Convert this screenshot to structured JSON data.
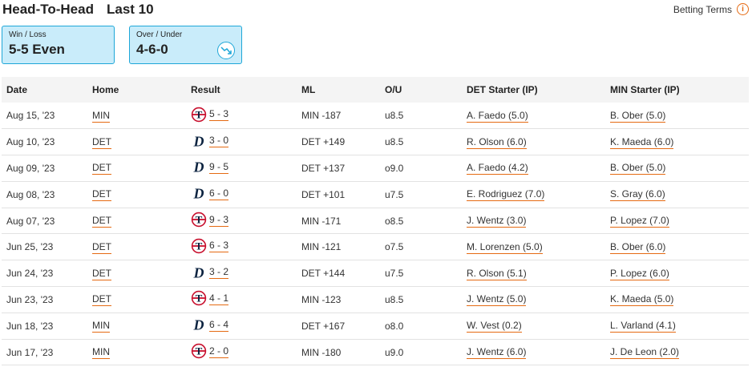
{
  "header": {
    "title": "Head-To-Head",
    "subtitle": "Last 10"
  },
  "betting_terms": {
    "label": "Betting Terms",
    "icon": "info-icon"
  },
  "cards": {
    "win_loss": {
      "label": "Win / Loss",
      "value": "5-5 Even"
    },
    "over_under": {
      "label": "Over / Under",
      "value": "4-6-0",
      "icon": "trend-down-icon"
    }
  },
  "colors": {
    "accent": "#e56a12",
    "card_bg": "#c9ecfa",
    "card_border": "#1ea7d8",
    "twins_red": "#c8102e",
    "twins_navy": "#0c2340",
    "tigers_navy": "#0c2340"
  },
  "table": {
    "columns": [
      "Date",
      "Home",
      "Result",
      "ML",
      "O/U",
      "DET Starter (IP)",
      "MIN Starter (IP)"
    ],
    "rows": [
      {
        "date": "Aug 15, '23",
        "home": "MIN",
        "winner": "MIN",
        "score": "5 - 3",
        "ml": "MIN -187",
        "ou": "u8.5",
        "det": "A. Faedo (5.0)",
        "min": "B. Ober (5.0)"
      },
      {
        "date": "Aug 10, '23",
        "home": "DET",
        "winner": "DET",
        "score": "3 - 0",
        "ml": "DET +149",
        "ou": "u8.5",
        "det": "R. Olson (6.0)",
        "min": "K. Maeda (6.0)"
      },
      {
        "date": "Aug 09, '23",
        "home": "DET",
        "winner": "DET",
        "score": "9 - 5",
        "ml": "DET +137",
        "ou": "o9.0",
        "det": "A. Faedo (4.2)",
        "min": "B. Ober (5.0)"
      },
      {
        "date": "Aug 08, '23",
        "home": "DET",
        "winner": "DET",
        "score": "6 - 0",
        "ml": "DET +101",
        "ou": "u7.5",
        "det": "E. Rodriguez (7.0)",
        "min": "S. Gray (6.0)"
      },
      {
        "date": "Aug 07, '23",
        "home": "DET",
        "winner": "MIN",
        "score": "9 - 3",
        "ml": "MIN -171",
        "ou": "o8.5",
        "det": "J. Wentz (3.0)",
        "min": "P. Lopez (7.0)"
      },
      {
        "date": "Jun 25, '23",
        "home": "DET",
        "winner": "MIN",
        "score": "6 - 3",
        "ml": "MIN -121",
        "ou": "o7.5",
        "det": "M. Lorenzen (5.0)",
        "min": "B. Ober (6.0)"
      },
      {
        "date": "Jun 24, '23",
        "home": "DET",
        "winner": "DET",
        "score": "3 - 2",
        "ml": "DET +144",
        "ou": "u7.5",
        "det": "R. Olson (5.1)",
        "min": "P. Lopez (6.0)"
      },
      {
        "date": "Jun 23, '23",
        "home": "DET",
        "winner": "MIN",
        "score": "4 - 1",
        "ml": "MIN -123",
        "ou": "u8.5",
        "det": "J. Wentz (5.0)",
        "min": "K. Maeda (5.0)"
      },
      {
        "date": "Jun 18, '23",
        "home": "MIN",
        "winner": "DET",
        "score": "6 - 4",
        "ml": "DET +167",
        "ou": "o8.0",
        "det": "W. Vest (0.2)",
        "min": "L. Varland (4.1)"
      },
      {
        "date": "Jun 17, '23",
        "home": "MIN",
        "winner": "MIN",
        "score": "2 - 0",
        "ml": "MIN -180",
        "ou": "u9.0",
        "det": "J. Wentz (6.0)",
        "min": "J. De Leon (2.0)"
      }
    ]
  }
}
